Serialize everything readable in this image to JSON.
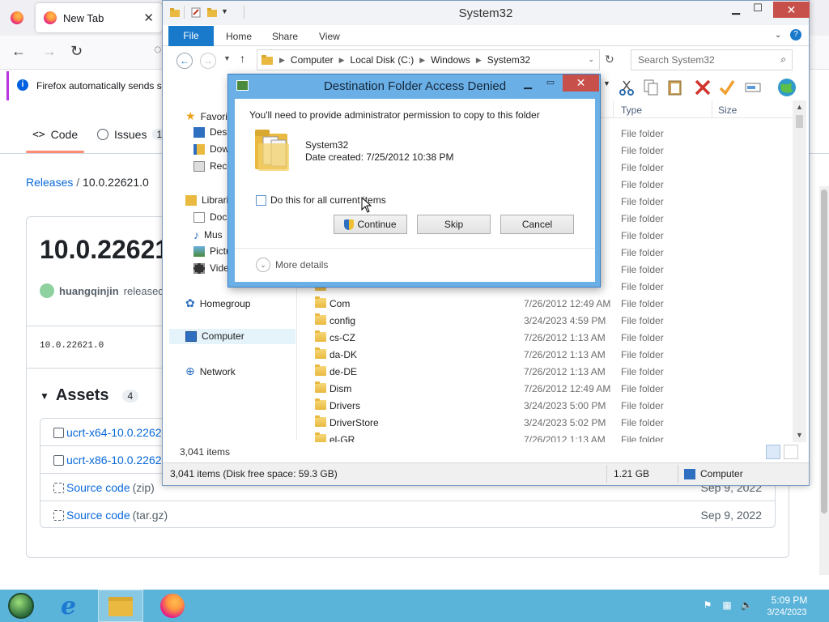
{
  "firefox": {
    "tab_title": "New Tab",
    "notice": "Firefox automatically sends so"
  },
  "github": {
    "tabs": [
      "Code",
      "Issues"
    ],
    "issues_count": "1",
    "breadcrumb_link": "Releases",
    "breadcrumb_current": "10.0.22621.0",
    "release_title": "10.0.22621.",
    "author": "huangqinjin",
    "author_action": "releasec",
    "tag": "10.0.22621.0",
    "assets_label": "Assets",
    "assets_count": "4",
    "assets": [
      {
        "name": "ucrt-x64-10.0.2262",
        "ext": "",
        "date": ""
      },
      {
        "name": "ucrt-x86-10.0.2262",
        "ext": "",
        "date": ""
      },
      {
        "name": "Source code",
        "ext": "(zip)",
        "date": "Sep 9, 2022"
      },
      {
        "name": "Source code",
        "ext": "(tar.gz)",
        "date": "Sep 9, 2022"
      }
    ]
  },
  "explorer": {
    "title": "System32",
    "ribbon_tabs": [
      "File",
      "Home",
      "Share",
      "View"
    ],
    "address": [
      "Computer",
      "Local Disk (C:)",
      "Windows",
      "System32"
    ],
    "search_placeholder": "Search System32",
    "nav": {
      "favorites": "Favori",
      "desktop": "Desk",
      "downloads": "Dow",
      "recent": "Rece",
      "libraries": "Librari",
      "documents": "Doc",
      "music": "Mus",
      "pictures": "Pictu",
      "videos": "Vide",
      "homegroup": "Homegroup",
      "computer": "Computer",
      "network": "Network"
    },
    "columns": {
      "type": "Type",
      "size": "Size"
    },
    "hidden_rows": [
      "File folder",
      "File folder",
      "File folder",
      "File folder",
      "File folder",
      "File folder",
      "File folder",
      "File folder",
      "File folder",
      "File folder"
    ],
    "files": [
      {
        "name": "",
        "date": "",
        "type": "File folder"
      },
      {
        "name": "Com",
        "date": "7/26/2012 12:49 AM",
        "type": "File folder"
      },
      {
        "name": "config",
        "date": "3/24/2023 4:59 PM",
        "type": "File folder"
      },
      {
        "name": "cs-CZ",
        "date": "7/26/2012 1:13 AM",
        "type": "File folder"
      },
      {
        "name": "da-DK",
        "date": "7/26/2012 1:13 AM",
        "type": "File folder"
      },
      {
        "name": "de-DE",
        "date": "7/26/2012 1:13 AM",
        "type": "File folder"
      },
      {
        "name": "Dism",
        "date": "7/26/2012 12:49 AM",
        "type": "File folder"
      },
      {
        "name": "Drivers",
        "date": "3/24/2023 5:00 PM",
        "type": "File folder"
      },
      {
        "name": "DriverStore",
        "date": "3/24/2023 5:02 PM",
        "type": "File folder"
      },
      {
        "name": "el-GR",
        "date": "7/26/2012 1:13 AM",
        "type": "File folder"
      }
    ],
    "item_count": "3,041 items",
    "status_left": "3,041 items (Disk free space: 59.3 GB)",
    "status_size": "1.21 GB",
    "status_location": "Computer"
  },
  "dialog": {
    "title": "Destination Folder Access Denied",
    "message": "You'll need to provide administrator permission to copy to this folder",
    "folder_name": "System32",
    "folder_date": "Date created: 7/25/2012 10:38 PM",
    "checkbox_label": "Do this for all current items",
    "continue": "Continue",
    "skip": "Skip",
    "cancel": "Cancel",
    "more_details": "More details"
  },
  "taskbar": {
    "time": "5:09 PM",
    "date": "3/24/2023"
  }
}
